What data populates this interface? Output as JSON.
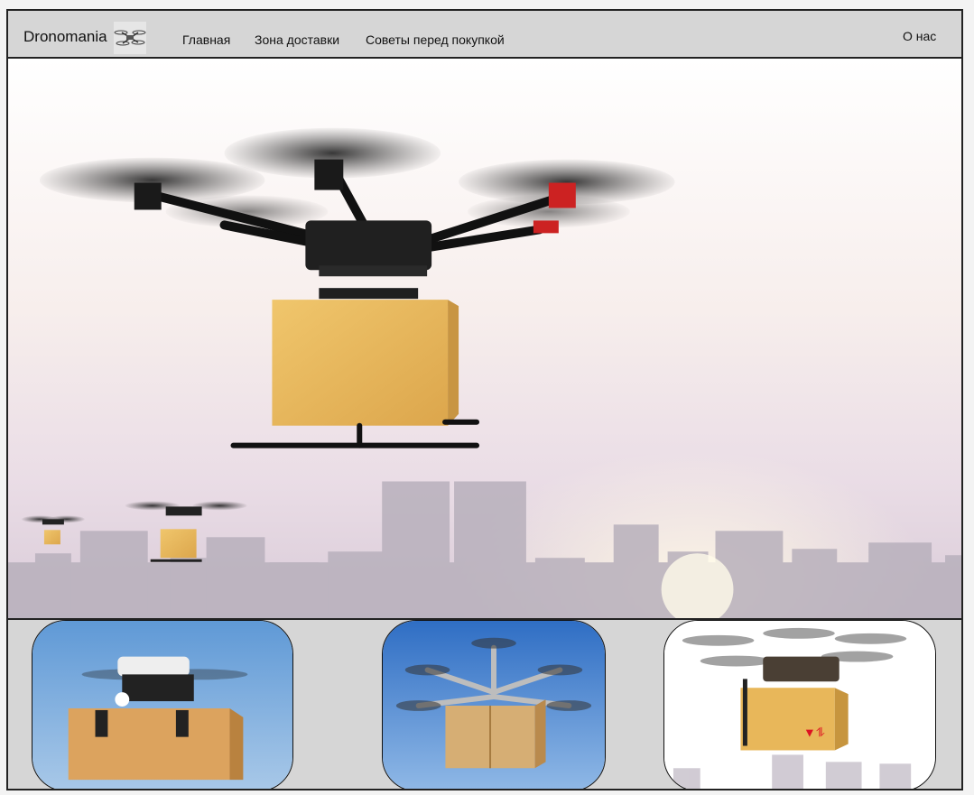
{
  "header": {
    "brand": "Dronomania",
    "brand_icon": "drone-icon",
    "nav": [
      {
        "label": "Главная"
      },
      {
        "label": "Зона доставки"
      },
      {
        "label": "Советы перед покупкой"
      }
    ],
    "about_label": "О нас"
  },
  "hero": {
    "image": "delivery-drone-city-skyline"
  },
  "cards": [
    {
      "image": "drone-with-box-blue-sky"
    },
    {
      "image": "hexacopter-with-parcel"
    },
    {
      "image": "octocopter-with-fragile-box"
    }
  ],
  "colors": {
    "nav_bg": "#d6d6d6",
    "border": "#222222",
    "box": "#e8b75a",
    "sky_card1": "#6fa6d8",
    "sky_card2": "#3b7fd0"
  }
}
